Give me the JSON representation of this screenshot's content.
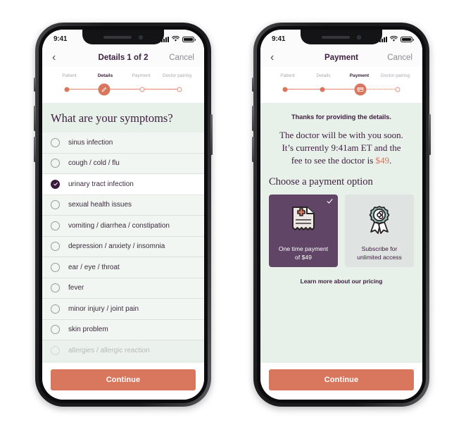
{
  "colors": {
    "accent_coral": "#d9775e",
    "deep_purple": "#3e2040",
    "card_selected_purple": "#604566",
    "mint_background": "#e8f0ea",
    "badge_teal": "#9ec9c3"
  },
  "phones": [
    {
      "id": "details-screen",
      "status_bar": {
        "time": "9:41",
        "signal_icon": "cellular-bars-icon",
        "wifi_icon": "wifi-icon",
        "battery_icon": "battery-icon"
      },
      "nav": {
        "back_icon": "chevron-left-icon",
        "title": "Details 1 of 2",
        "cancel_label": "Cancel"
      },
      "stepper": {
        "steps": [
          {
            "label": "Patient",
            "state": "done",
            "icon": "filled-dot-icon"
          },
          {
            "label": "Details",
            "state": "current",
            "icon": "pencil-icon"
          },
          {
            "label": "Payment",
            "state": "todo",
            "icon": "hollow-dot-icon"
          },
          {
            "label": "Doctor pairing",
            "state": "todo",
            "icon": "hollow-dot-icon"
          }
        ]
      },
      "heading": "What are your symptoms?",
      "symptoms": [
        {
          "label": "sinus infection",
          "checked": false,
          "faded": false
        },
        {
          "label": "cough / cold / flu",
          "checked": false,
          "faded": false
        },
        {
          "label": "urinary tract infection",
          "checked": true,
          "faded": false
        },
        {
          "label": "sexual health issues",
          "checked": false,
          "faded": false
        },
        {
          "label": "vomiting / diarrhea / constipation",
          "checked": false,
          "faded": false
        },
        {
          "label": "depression / anxiety / insomnia",
          "checked": false,
          "faded": false
        },
        {
          "label": "ear / eye / throat",
          "checked": false,
          "faded": false
        },
        {
          "label": "fever",
          "checked": false,
          "faded": false
        },
        {
          "label": "minor injury / joint pain",
          "checked": false,
          "faded": false
        },
        {
          "label": "skin problem",
          "checked": false,
          "faded": false
        },
        {
          "label": "allergies / allergic reaction",
          "checked": false,
          "faded": true
        }
      ],
      "cta_label": "Continue"
    },
    {
      "id": "payment-screen",
      "status_bar": {
        "time": "9:41",
        "signal_icon": "cellular-bars-icon",
        "wifi_icon": "wifi-icon",
        "battery_icon": "battery-icon"
      },
      "nav": {
        "back_icon": "chevron-left-icon",
        "title": "Payment",
        "cancel_label": "Cancel"
      },
      "stepper": {
        "steps": [
          {
            "label": "Patient",
            "state": "done",
            "icon": "filled-dot-icon"
          },
          {
            "label": "Details",
            "state": "done",
            "icon": "filled-dot-icon"
          },
          {
            "label": "Payment",
            "state": "current",
            "icon": "credit-card-icon"
          },
          {
            "label": "Doctor pairing",
            "state": "todo",
            "icon": "hollow-dot-icon"
          }
        ]
      },
      "thanks": "Thanks for providing the details.",
      "lead_line1": "The doctor will be with you soon.",
      "lead_line2_pre": "It’s currently 9:41am ET and the",
      "lead_line3_pre": "fee to see the doctor is ",
      "lead_price": "$49",
      "lead_line3_post": ".",
      "choose_heading": "Choose a payment option",
      "options": [
        {
          "line1": "One time payment",
          "line2": "of $49",
          "selected": true,
          "icon": "medical-receipt-icon",
          "check_icon": "check-icon"
        },
        {
          "line1": "Subscribe for",
          "line2": "unlimited access",
          "selected": false,
          "icon": "infinity-rosette-icon"
        }
      ],
      "learn_more": "Learn more about our pricing",
      "cta_label": "Continue"
    }
  ]
}
